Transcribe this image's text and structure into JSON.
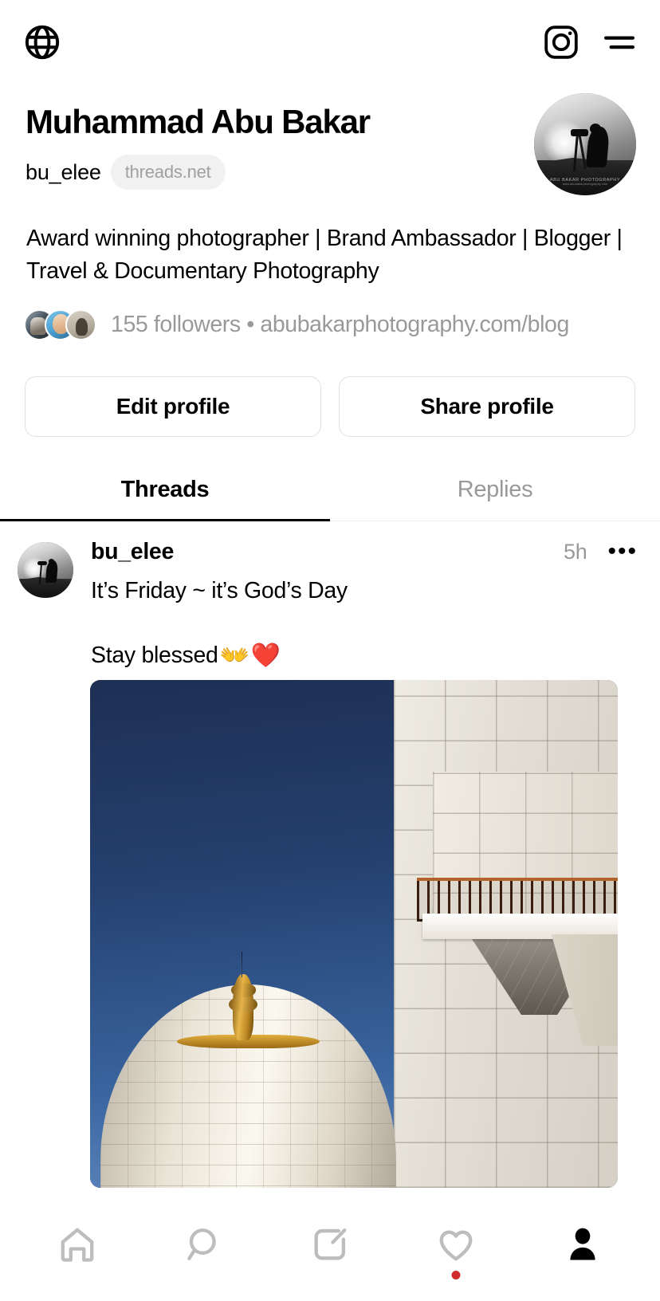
{
  "topbar": {
    "globe_icon": "globe-icon",
    "instagram_icon": "instagram-icon",
    "menu_icon": "hamburger-menu-icon"
  },
  "profile": {
    "display_name": "Muhammad Abu Bakar",
    "handle": "bu_elee",
    "domain_badge": "threads.net",
    "bio": "Award winning photographer | Brand Ambassador | Blogger | Travel & Documentary Photography",
    "followers": "155 followers",
    "separator": "•",
    "link": "abubakarphotography.com/blog",
    "avatar_watermark": "ABU BAKAR PHOTOGRAPHY",
    "avatar_watermark_sub": "www.abubakarphotography.com"
  },
  "actions": {
    "edit_profile": "Edit profile",
    "share_profile": "Share profile"
  },
  "tabs": [
    {
      "label": "Threads",
      "active": true
    },
    {
      "label": "Replies",
      "active": false
    }
  ],
  "post": {
    "username": "bu_elee",
    "timestamp": "5h",
    "menu": "•••",
    "text_line1": "It’s Friday ~ it’s God’s Day",
    "text_line2": "Stay blessed ",
    "emoji_hands": "👐",
    "emoji_heart": "❤️",
    "image_alt": "mosque-dome-and-minaret-photo"
  },
  "bottom_nav": [
    {
      "name": "home",
      "icon": "home-icon",
      "active": false,
      "badge": false
    },
    {
      "name": "search",
      "icon": "search-icon",
      "active": false,
      "badge": false
    },
    {
      "name": "compose",
      "icon": "compose-icon",
      "active": false,
      "badge": false
    },
    {
      "name": "activity",
      "icon": "heart-icon",
      "active": false,
      "badge": true
    },
    {
      "name": "profile",
      "icon": "person-icon",
      "active": true,
      "badge": false
    }
  ],
  "colors": {
    "accent_black": "#000000",
    "muted_gray": "#999999",
    "badge_bg": "#f1f1f1",
    "border": "#e0e0e0",
    "notification_dot": "#d12b2b",
    "photo_sky": "#24406e",
    "photo_marble": "#efece4",
    "photo_gold": "#c08a24"
  }
}
